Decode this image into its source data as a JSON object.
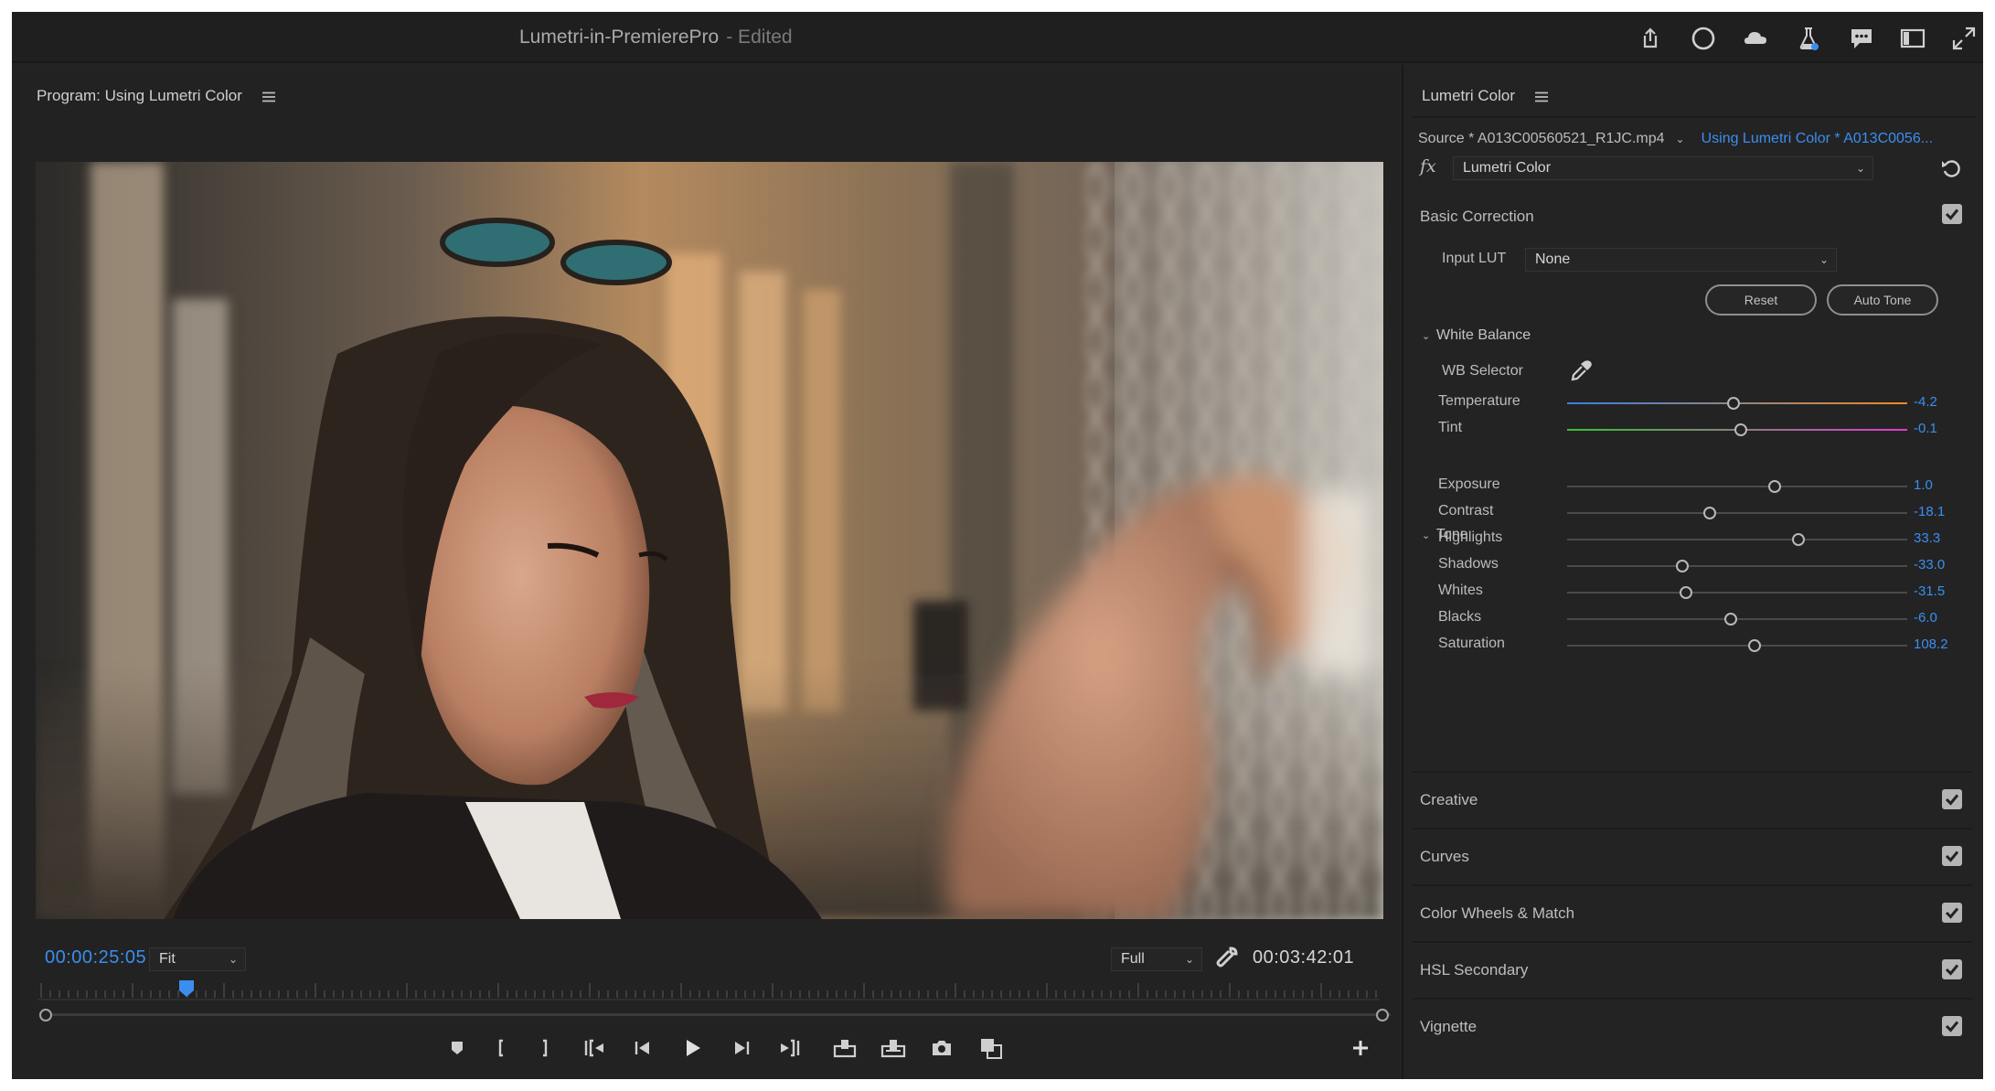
{
  "window": {
    "app_title": "Lumetri-in-PremierePro",
    "edited_label": "- Edited",
    "toolbar_icons": [
      "share-icon",
      "circle-icon",
      "cloud-icon",
      "flask-icon",
      "comment-icon",
      "panel-layout-icon",
      "fullscreen-icon"
    ]
  },
  "program": {
    "tab_label": "Program: Using Lumetri Color",
    "timecode_current": "00:00:25:05",
    "zoom_select": "Fit",
    "resolution_select": "Full",
    "timecode_total": "00:03:42:01",
    "playhead_position_fraction": 0.1
  },
  "lumetri": {
    "tab_label": "Lumetri Color",
    "source_label": "Source * A013C00560521_R1JC.mp4",
    "sequence_link": "Using Lumetri Color * A013C0056...",
    "fx_label": "fx",
    "effect_select": "Lumetri Color",
    "basic_correction": {
      "title": "Basic Correction",
      "input_lut_label": "Input LUT",
      "input_lut_value": "None",
      "reset_label": "Reset",
      "auto_tone_label": "Auto Tone",
      "white_balance_label": "White Balance",
      "wb_selector_label": "WB Selector",
      "tone_label": "Tone",
      "white_balance_sliders": [
        {
          "name": "Temperature",
          "value": "-4.2",
          "fraction": 0.49
        },
        {
          "name": "Tint",
          "value": "-0.1",
          "fraction": 0.51
        }
      ],
      "tone_sliders": [
        {
          "name": "Exposure",
          "value": "1.0",
          "fraction": 0.61
        },
        {
          "name": "Contrast",
          "value": "-18.1",
          "fraction": 0.42
        },
        {
          "name": "Highlights",
          "value": "33.3",
          "fraction": 0.68
        },
        {
          "name": "Shadows",
          "value": "-33.0",
          "fraction": 0.34
        },
        {
          "name": "Whites",
          "value": "-31.5",
          "fraction": 0.35
        },
        {
          "name": "Blacks",
          "value": "-6.0",
          "fraction": 0.48
        },
        {
          "name": "Saturation",
          "value": "108.2",
          "fraction": 0.55
        }
      ]
    },
    "sections": [
      {
        "title": "Creative"
      },
      {
        "title": "Curves"
      },
      {
        "title": "Color Wheels & Match"
      },
      {
        "title": "HSL Secondary"
      },
      {
        "title": "Vignette"
      }
    ]
  },
  "colors": {
    "accent_blue": "#3b8ef0",
    "temperature_gradient": [
      "#3a7ee0",
      "#f08a24"
    ],
    "tint_gradient": [
      "#34c234",
      "#e13ad0"
    ]
  }
}
